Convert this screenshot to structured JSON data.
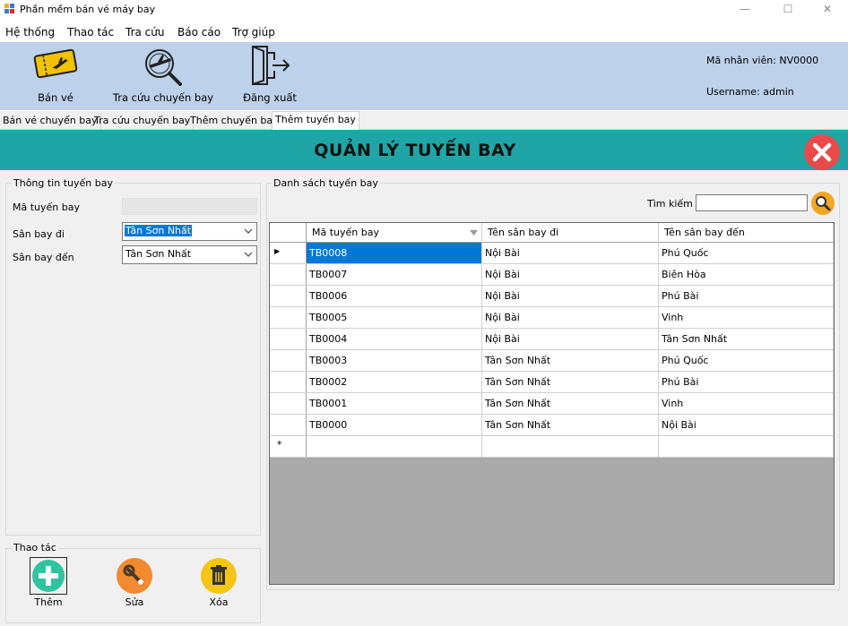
{
  "window": {
    "title": "Phần mềm bán vé máy bay",
    "minimize": "—",
    "maximize": "☐",
    "close": "✕"
  },
  "menu": [
    "Hệ thống",
    "Thao tác",
    "Tra cứu",
    "Báo cáo",
    "Trợ giúp"
  ],
  "toolbar": {
    "ban_ve": "Bán vé",
    "tra_cuu": "Tra cứu chuyến bay",
    "dang_xuat": "Đăng xuất"
  },
  "user": {
    "employee": "Mã nhân viên: NV0000",
    "username": "Username: admin"
  },
  "tabs": [
    "Bán vé chuyến bay",
    "Tra cứu chuyến bay",
    "Thêm chuyến bay",
    "Thêm tuyến bay"
  ],
  "page_title": "QUẢN LÝ TUYẾN BAY",
  "info_group": {
    "legend": "Thông tin tuyến bay",
    "ma_label": "Mã tuyến bay",
    "di_label": "Sân bay đi",
    "den_label": "Sân bay đến",
    "di_value": "Tân Sơn Nhất",
    "den_value": "Tân Sơn Nhất"
  },
  "actions_group": {
    "legend": "Thao tác",
    "add": "Thêm",
    "edit": "Sửa",
    "delete": "Xóa"
  },
  "list_group": {
    "legend": "Danh sách tuyến bay",
    "search_label": "Tìm kiếm",
    "search_value": ""
  },
  "table": {
    "columns": [
      "Mã tuyến bay",
      "Tên sân bay đi",
      "Tên sân bay đến"
    ],
    "rows": [
      [
        "TB0008",
        "Nội Bài",
        "Phú Quốc"
      ],
      [
        "TB0007",
        "Nội Bài",
        "Biên Hòa"
      ],
      [
        "TB0006",
        "Nội Bài",
        "Phú Bài"
      ],
      [
        "TB0005",
        "Nội Bài",
        "Vinh"
      ],
      [
        "TB0004",
        "Nội Bài",
        "Tân Sơn Nhất"
      ],
      [
        "TB0003",
        "Tân Sơn Nhất",
        "Phú Quốc"
      ],
      [
        "TB0002",
        "Tân Sơn Nhất",
        "Phú Bài"
      ],
      [
        "TB0001",
        "Tân Sơn Nhất",
        "Vinh"
      ],
      [
        "TB0000",
        "Tân Sơn Nhất",
        "Nội Bài"
      ]
    ],
    "current_row_marker": "▶",
    "new_row_marker": "*"
  },
  "colors": {
    "toolbar_bg": "#bdd1ea",
    "header_band": "#1fa5a5",
    "close_red": "#e94a4a",
    "add_green": "#2ec4a0",
    "edit_orange": "#f28a30",
    "delete_yellow": "#f5c518",
    "selection_blue": "#0078d7"
  }
}
